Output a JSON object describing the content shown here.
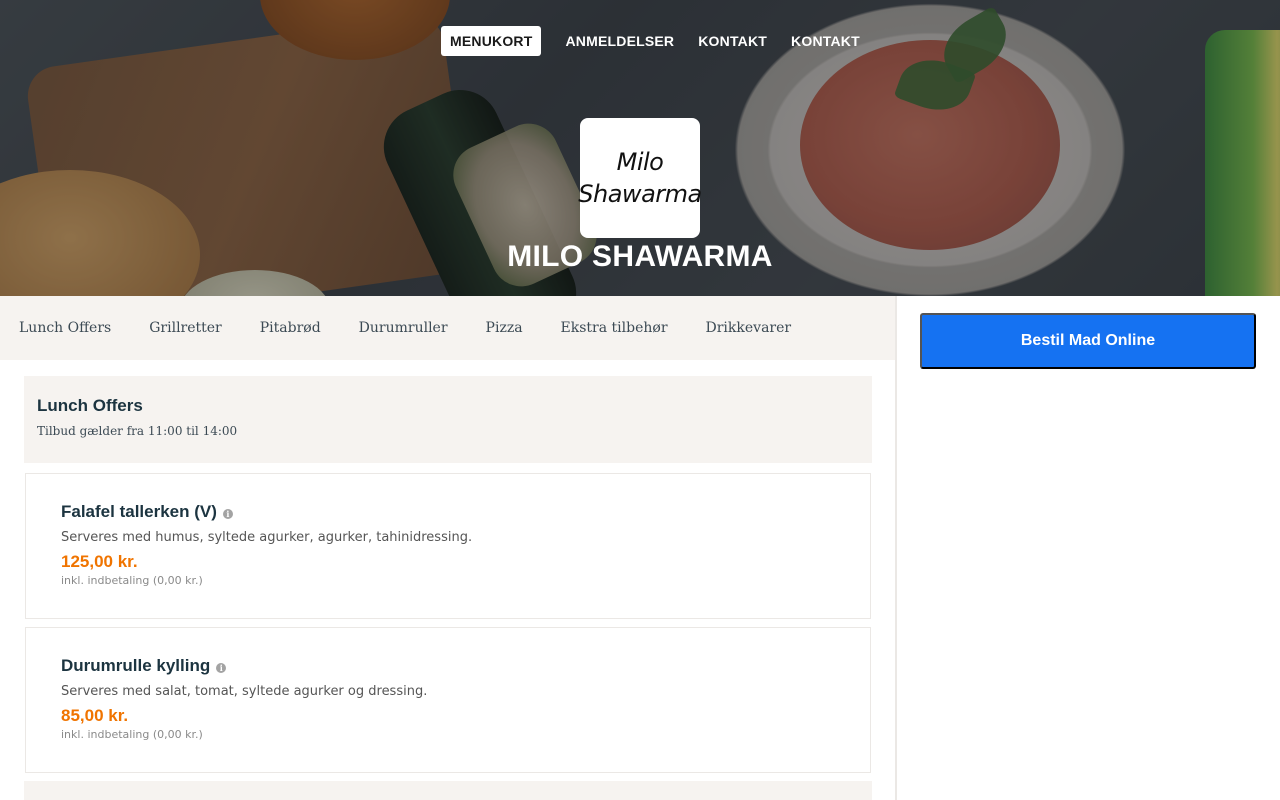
{
  "nav": {
    "items": [
      {
        "label": "MENUKORT",
        "active": true
      },
      {
        "label": "ANMELDELSER",
        "active": false
      },
      {
        "label": "KONTAKT",
        "active": false
      },
      {
        "label": "KONTAKT",
        "active": false
      }
    ]
  },
  "logo": {
    "line1": "Milo",
    "line2": "Shawarma"
  },
  "restaurant": {
    "name": "MILO SHAWARMA"
  },
  "categories": [
    "Lunch Offers",
    "Grillretter",
    "Pitabrød",
    "Durumruller",
    "Pizza",
    "Ekstra tilbehør",
    "Drikkevarer"
  ],
  "sidebar": {
    "order_button": "Bestil Mad Online"
  },
  "section": {
    "title": "Lunch Offers",
    "subtitle": "Tilbud gælder fra 11:00 til 14:00"
  },
  "items": [
    {
      "name": "Falafel tallerken (V)",
      "description": "Serveres med humus, syltede agurker, agurker, tahinidressing.",
      "price": "125,00 kr.",
      "note": "inkl. indbetaling (0,00 kr.)"
    },
    {
      "name": "Durumrulle kylling",
      "description": "Serveres med salat, tomat, syltede agurker og dressing.",
      "price": "85,00 kr.",
      "note": "inkl. indbetaling (0,00 kr.)"
    }
  ],
  "colors": {
    "accent": "#1572f2",
    "price": "#f07400",
    "heading": "#1c3440",
    "panel": "#f6f3f0"
  }
}
